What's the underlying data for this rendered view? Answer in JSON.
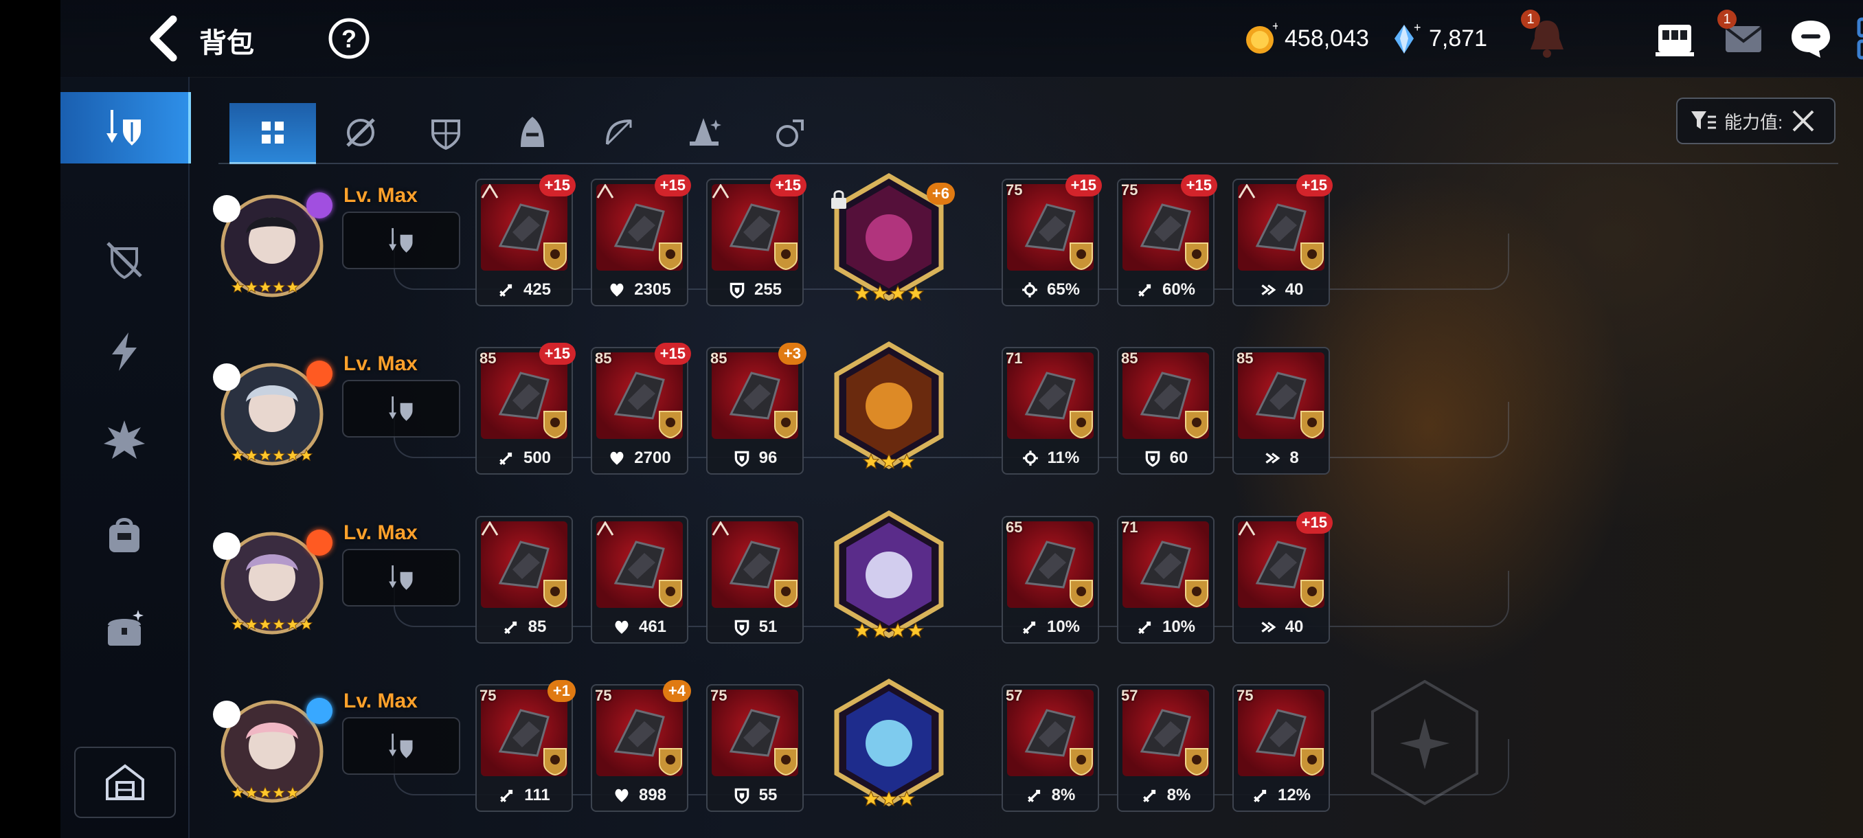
{
  "header": {
    "title": "背包",
    "currencies": [
      {
        "icon": "gold-coin-icon",
        "value": "458,043"
      },
      {
        "icon": "crystal-icon",
        "value": "7,871"
      }
    ],
    "icons": [
      {
        "name": "notification-bell-icon",
        "badge": "1"
      },
      {
        "name": "shop-icon",
        "badge": ""
      },
      {
        "name": "mail-icon",
        "badge": "1"
      },
      {
        "name": "chat-icon",
        "badge": ""
      },
      {
        "name": "menu-grid-icon",
        "badge": ""
      }
    ]
  },
  "sidebar": {
    "items": [
      {
        "name": "equipment-icon",
        "active": true
      },
      {
        "name": "unequipped-icon",
        "active": false
      },
      {
        "name": "lightning-icon",
        "active": false
      },
      {
        "name": "burst-icon",
        "active": false
      },
      {
        "name": "bag-icon",
        "active": false
      },
      {
        "name": "chest-icon",
        "active": false
      }
    ],
    "bottom": {
      "name": "storage-icon"
    }
  },
  "tabs": [
    {
      "name": "all-icon",
      "active": true
    },
    {
      "name": "weapon-icon"
    },
    {
      "name": "armor-icon"
    },
    {
      "name": "helmet-icon"
    },
    {
      "name": "bow-icon"
    },
    {
      "name": "hat-icon"
    },
    {
      "name": "ring-icon"
    }
  ],
  "filter": {
    "label": "能力值:"
  },
  "rows": [
    {
      "level": "Lv. Max",
      "stars": 5,
      "element": "dark",
      "items": [
        {
          "lvl": "",
          "plus": "+15",
          "stat": "425",
          "stat_icon": "attack"
        },
        {
          "lvl": "",
          "plus": "+15",
          "stat": "2305",
          "stat_icon": "health"
        },
        {
          "lvl": "",
          "plus": "+15",
          "stat": "255",
          "stat_icon": "defense"
        },
        {
          "lvl": "75",
          "plus": "+15",
          "stat": "65%",
          "stat_icon": "crit"
        },
        {
          "lvl": "75",
          "plus": "+15",
          "stat": "60%",
          "stat_icon": "attack"
        },
        {
          "lvl": "",
          "plus": "+15",
          "stat": "40",
          "stat_icon": "speed"
        }
      ],
      "artifact": {
        "plus": "+6",
        "stars": 4,
        "locked": true
      }
    },
    {
      "level": "Lv. Max",
      "stars": 6,
      "element": "fire",
      "items": [
        {
          "lvl": "85",
          "plus": "+15",
          "stat": "500",
          "stat_icon": "attack"
        },
        {
          "lvl": "85",
          "plus": "+15",
          "stat": "2700",
          "stat_icon": "health"
        },
        {
          "lvl": "85",
          "plus": "+3",
          "stat": "96",
          "stat_icon": "defense"
        },
        {
          "lvl": "71",
          "plus": "",
          "stat": "11%",
          "stat_icon": "crit"
        },
        {
          "lvl": "85",
          "plus": "",
          "stat": "60",
          "stat_icon": "defense"
        },
        {
          "lvl": "85",
          "plus": "",
          "stat": "8",
          "stat_icon": "speed"
        }
      ],
      "artifact": {
        "plus": "",
        "stars": 3,
        "locked": false
      }
    },
    {
      "level": "Lv. Max",
      "stars": 6,
      "element": "fire",
      "items": [
        {
          "lvl": "",
          "plus": "",
          "stat": "85",
          "stat_icon": "attack"
        },
        {
          "lvl": "",
          "plus": "",
          "stat": "461",
          "stat_icon": "health"
        },
        {
          "lvl": "",
          "plus": "",
          "stat": "51",
          "stat_icon": "defense"
        },
        {
          "lvl": "65",
          "plus": "",
          "stat": "10%",
          "stat_icon": "attack"
        },
        {
          "lvl": "71",
          "plus": "",
          "stat": "10%",
          "stat_icon": "attack"
        },
        {
          "lvl": "",
          "plus": "+15",
          "stat": "40",
          "stat_icon": "speed"
        }
      ],
      "artifact": {
        "plus": "",
        "stars": 4,
        "locked": false
      }
    },
    {
      "level": "Lv. Max",
      "stars": 5,
      "element": "water",
      "items": [
        {
          "lvl": "75",
          "plus": "+1",
          "stat": "111",
          "stat_icon": "attack"
        },
        {
          "lvl": "75",
          "plus": "+4",
          "stat": "898",
          "stat_icon": "health"
        },
        {
          "lvl": "75",
          "plus": "",
          "stat": "55",
          "stat_icon": "defense"
        },
        {
          "lvl": "57",
          "plus": "",
          "stat": "8%",
          "stat_icon": "attack"
        },
        {
          "lvl": "57",
          "plus": "",
          "stat": "8%",
          "stat_icon": "attack"
        },
        {
          "lvl": "75",
          "plus": "",
          "stat": "12%",
          "stat_icon": "attack"
        }
      ],
      "artifact": {
        "plus": "",
        "stars": 3,
        "locked": false
      }
    }
  ]
}
